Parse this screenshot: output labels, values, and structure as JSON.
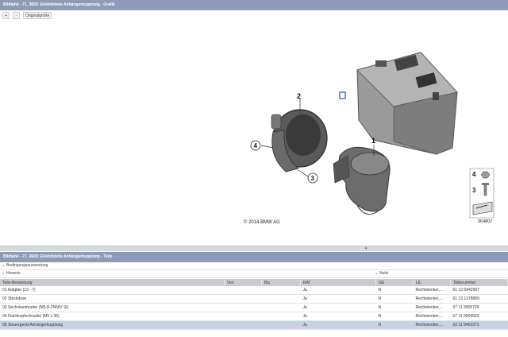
{
  "window": {
    "title_top": "Bildtafel - 71_3605: Elektrikteile Anhängerkupplung - Grafik",
    "title_bottom": "Bildtafel - 71_3605: Elektrikteile Anhängerkupplung - Teile"
  },
  "toolbar": {
    "zoom_in": "+",
    "zoom_out": "-",
    "original_size": "Originalgröße"
  },
  "diagram": {
    "callouts": [
      "1",
      "2",
      "3",
      "4"
    ],
    "copyright": "© 2014 BMW AG",
    "inset_labels": [
      "4",
      "3"
    ],
    "inset_number": "364807"
  },
  "sections": {
    "conditions": "Bedingungsauswertung",
    "notes": "Hinweis",
    "remark": "Notiz"
  },
  "table": {
    "columns": [
      "Teile-Benennung",
      "Von",
      "Bis",
      "KAT",
      "GE",
      "LE",
      "Teilenummer"
    ],
    "rows": [
      [
        "01 Adapter (13 - 7)",
        "",
        "",
        "Ja",
        "N",
        "Rechtslenker,...",
        "61 13 6942997"
      ],
      [
        "02 Steckdose",
        "",
        "",
        "Ja",
        "N",
        "Rechtslenker,...",
        "61 13 1378889"
      ],
      [
        "03 Sechskantmutter (M5-8-ZNNIV SI)",
        "",
        "",
        "Ja",
        "N",
        "Rechtslenker,...",
        "07 11 9905739"
      ],
      [
        "04 Flachkopfschraube (M5 x 35)",
        "",
        "",
        "Ja",
        "N",
        "Rechtslenker,...",
        "07 11 9904592"
      ],
      [
        "05 Steuergerät Anhängerkupplung",
        "",
        "",
        "Ja",
        "N",
        "Rechtslenker,...",
        "63 11 9463373"
      ]
    ],
    "selected_row": 4
  }
}
